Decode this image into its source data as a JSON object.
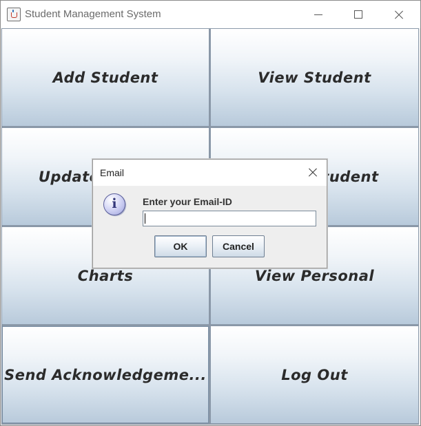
{
  "window": {
    "title": "Student Management System"
  },
  "menu_tiles": [
    {
      "label": "Add Student"
    },
    {
      "label": "View Student"
    },
    {
      "label": "Update Student"
    },
    {
      "label": "Delete Student"
    },
    {
      "label": "Charts"
    },
    {
      "label": "View Personal"
    },
    {
      "label": "Send Acknowledgeme..."
    },
    {
      "label": "Log Out"
    }
  ],
  "dialog": {
    "title": "Email",
    "icon": "information-icon",
    "icon_glyph": "i",
    "prompt": "Enter your Email-ID",
    "input_value": "",
    "input_placeholder": "",
    "ok_label": "OK",
    "cancel_label": "Cancel"
  }
}
